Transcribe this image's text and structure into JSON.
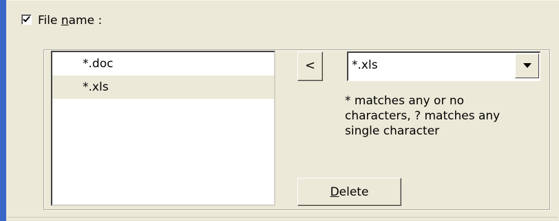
{
  "filter": {
    "checkbox_checked": true,
    "label_prefix": "File ",
    "label_mnemonic": "n",
    "label_suffix": "ame :"
  },
  "patterns": {
    "items": [
      {
        "label": "*.doc",
        "selected": false
      },
      {
        "label": "*.xls",
        "selected": true
      }
    ]
  },
  "add_button": {
    "label": "<"
  },
  "combo": {
    "value": "*.xls",
    "icon": "chevron-down-icon"
  },
  "help": {
    "text": "* matches any or no characters, ? matches any single character"
  },
  "delete_button": {
    "mnemonic": "D",
    "rest": "elete"
  },
  "colors": {
    "accent": "#3a66c6",
    "background": "#ece9d8"
  }
}
